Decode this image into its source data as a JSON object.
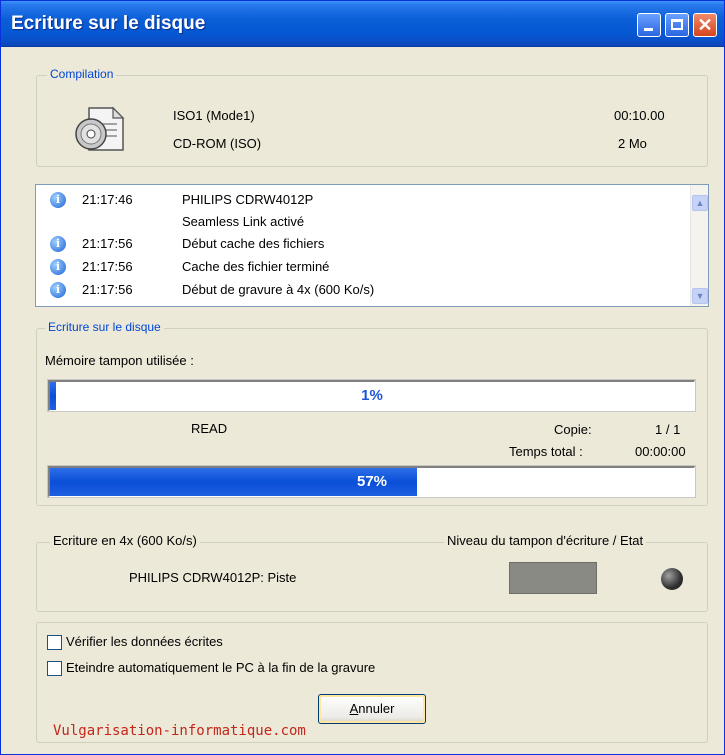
{
  "window": {
    "title": "Ecriture sur le disque"
  },
  "compilation": {
    "label": "Compilation",
    "format": "ISO1 (Mode1)",
    "duration": "00:10.00",
    "type": "CD-ROM (ISO)",
    "size": "2 Mo"
  },
  "log": [
    {
      "time": "21:17:46",
      "message": "PHILIPS CDRW4012P",
      "icon": true
    },
    {
      "time": "",
      "message": "Seamless Link activé",
      "icon": false
    },
    {
      "time": "21:17:56",
      "message": "Début cache des fichiers",
      "icon": true
    },
    {
      "time": "21:17:56",
      "message": "Cache des fichier terminé",
      "icon": true
    },
    {
      "time": "21:17:56",
      "message": "Début de gravure à 4x (600 Ko/s)",
      "icon": true
    }
  ],
  "writing": {
    "label": "Ecriture sur le disque",
    "buffer_label": "Mémoire tampon utilisée :",
    "buffer_percent": 1,
    "buffer_text": "1%",
    "status": "READ",
    "copy_label": "Copie:",
    "copy_value": "1 / 1",
    "total_time_label": "Temps total :",
    "total_time_value": "00:00:00",
    "progress_percent": 57,
    "progress_text": "57%"
  },
  "speed": {
    "label": "Ecriture en 4x (600 Ko/s)",
    "buffer_level_label": "Niveau du tampon d'écriture / Etat",
    "device_track": "PHILIPS CDRW4012P: Piste"
  },
  "options": {
    "verify_label": "Vérifier les données écrites",
    "verify_checked": false,
    "shutdown_label": "Eteindre automatiquement le PC à la fin de la gravure",
    "shutdown_checked": false
  },
  "buttons": {
    "cancel_label": "Annuler"
  },
  "watermark": "Vulgarisation-informatique.com",
  "colors": {
    "title_bar": "#0658d3",
    "progress_fill": "#0a4fd8",
    "watermark": "#c3261a"
  }
}
